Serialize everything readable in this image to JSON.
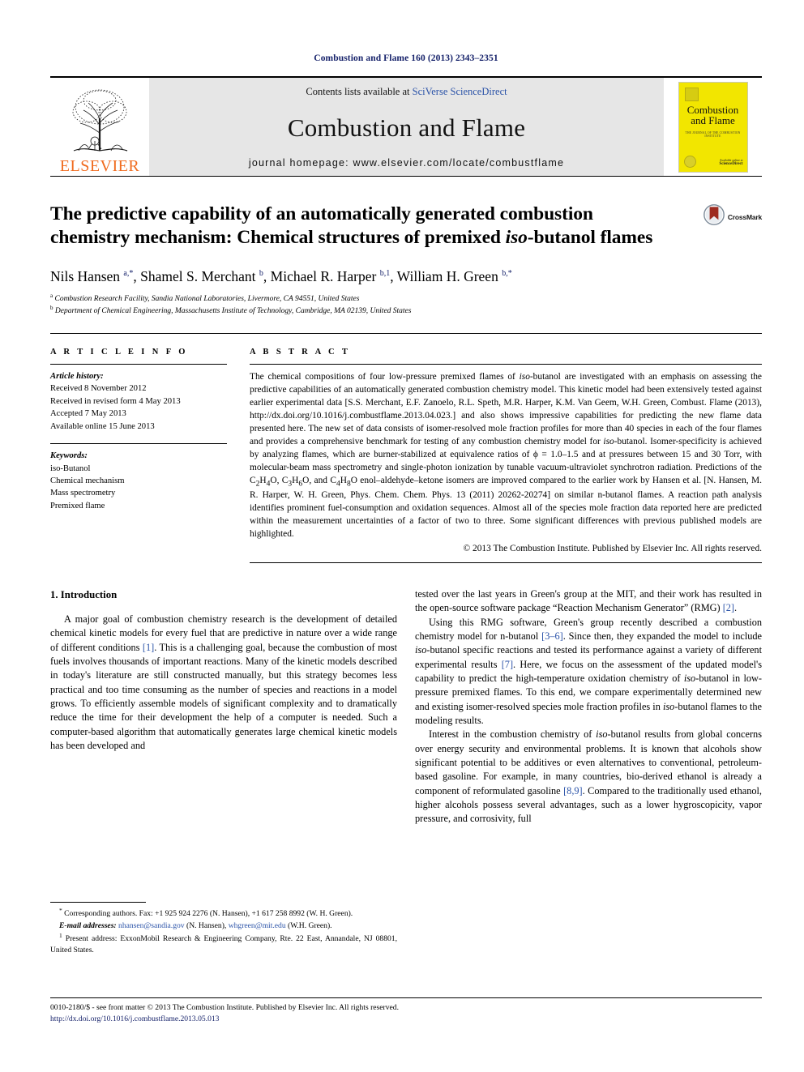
{
  "running_head": "Combustion and Flame 160 (2013) 2343–2351",
  "masthead": {
    "publisher_name": "ELSEVIER",
    "contents_prefix": "Contents lists available at ",
    "contents_link": "SciVerse ScienceDirect",
    "journal_title": "Combustion and Flame",
    "homepage": "journal homepage: www.elsevier.com/locate/combustflame",
    "cover": {
      "title_line1": "Combustion",
      "title_line2": "and Flame",
      "subtitle": "THE JOURNAL OF THE COMBUSTION INSTITUTE",
      "bottom_line1": "Available online at",
      "bottom_line2": "ScienceDirect"
    }
  },
  "article": {
    "title_part1": "The predictive capability of an automatically generated combustion chemistry mechanism: Chemical structures of premixed ",
    "title_italic": "iso",
    "title_part2": "-butanol flames",
    "crossmark_label": "CrossMark",
    "authors_html": "Nils Hansen <sup>a,*</sup>, Shamel S. Merchant <sup>b</sup>, Michael R. Harper <sup>b,1</sup>, William H. Green <sup>b,*</sup>",
    "affiliation_a": "Combustion Research Facility, Sandia National Laboratories, Livermore, CA 94551, United States",
    "affiliation_b": "Department of Chemical Engineering, Massachusetts Institute of Technology, Cambridge, MA 02139, United States"
  },
  "article_info": {
    "heading": "A R T I C L E  I N F O",
    "history_label": "Article history:",
    "history": [
      "Received 8 November 2012",
      "Received in revised form 4 May 2013",
      "Accepted 7 May 2013",
      "Available online 15 June 2013"
    ],
    "keywords_label": "Keywords:",
    "keywords": [
      "iso-Butanol",
      "Chemical mechanism",
      "Mass spectrometry",
      "Premixed flame"
    ]
  },
  "abstract": {
    "heading": "A B S T R A C T",
    "text_html": "The chemical compositions of four low-pressure premixed flames of <span class=\"it\">iso</span>-butanol are investigated with an emphasis on assessing the predictive capabilities of an automatically generated combustion chemistry model. This kinetic model had been extensively tested against earlier experimental data [S.S. Merchant, E.F. Zanoelo, R.L. Speth, M.R. Harper, K.M. Van Geem, W.H. Green, Combust. Flame (2013), http://dx.doi.org/10.1016/j.combustflame.2013.04.023.] and also shows impressive capabilities for predicting the new flame data presented here. The new set of data consists of isomer-resolved mole fraction profiles for more than 40 species in each of the four flames and provides a comprehensive benchmark for testing of any combustion chemistry model for <span class=\"it\">iso</span>-butanol. Isomer-specificity is achieved by analyzing flames, which are burner-stabilized at equivalence ratios of &#981; = 1.0&ndash;1.5 and at pressures between 15 and 30 Torr, with molecular-beam mass spectrometry and single-photon ionization by tunable vacuum-ultraviolet synchrotron radiation. Predictions of the C<sub>2</sub>H<sub>4</sub>O, C<sub>3</sub>H<sub>6</sub>O, and C<sub>4</sub>H<sub>8</sub>O enol&ndash;aldehyde&ndash;ketone isomers are improved compared to the earlier work by Hansen et al. [N. Hansen, M. R. Harper, W. H. Green, Phys. Chem. Chem. Phys. 13 (2011) 20262-20274] on similar n-butanol flames. A reaction path analysis identifies prominent fuel-consumption and oxidation sequences. Almost all of the species mole fraction data reported here are predicted within the measurement uncertainties of a factor of two to three. Some significant differences with previous published models are highlighted.",
    "copyright": "© 2013 The Combustion Institute. Published by Elsevier Inc. All rights reserved."
  },
  "introduction": {
    "heading": "1. Introduction",
    "left_paragraphs_html": [
      "A major goal of combustion chemistry research is the development of detailed chemical kinetic models for every fuel that are predictive in nature over a wide range of different conditions <span class=\"ref\">[1]</span>. This is a challenging goal, because the combustion of most fuels involves thousands of important reactions. Many of the kinetic models described in today's literature are still constructed manually, but this strategy becomes less practical and too time consuming as the number of species and reactions in a model grows. To efficiently assemble models of significant complexity and to dramatically reduce the time for their development the help of a computer is needed. Such a computer-based algorithm that automatically generates large chemical kinetic models has been developed and"
    ],
    "right_paragraphs_html": [
      "tested over the last years in Green's group at the MIT, and their work has resulted in the open-source software package &ldquo;Reaction Mechanism Generator&rdquo; (RMG) <span class=\"ref\">[2]</span>.",
      "Using this RMG software, Green's group recently described a combustion chemistry model for n-butanol <span class=\"ref\">[3&ndash;6]</span>. Since then, they expanded the model to include <span class=\"it\">iso</span>-butanol specific reactions and tested its performance against a variety of different experimental results <span class=\"ref\">[7]</span>. Here, we focus on the assessment of the updated model's capability to predict the high-temperature oxidation chemistry of <span class=\"it\">iso</span>-butanol in low-pressure premixed flames. To this end, we compare experimentally determined new and existing isomer-resolved species mole fraction profiles in <span class=\"it\">iso</span>-butanol flames to the modeling results.",
      "Interest in the combustion chemistry of <span class=\"it\">iso</span>-butanol results from global concerns over energy security and environmental problems. It is known that alcohols show significant potential to be additives or even alternatives to conventional, petroleum-based gasoline. For example, in many countries, bio-derived ethanol is already a component of reformulated gasoline <span class=\"ref\">[8,9]</span>. Compared to the traditionally used ethanol, higher alcohols possess several advantages, such as a lower hygroscopicity, vapor pressure, and corrosivity, full"
    ]
  },
  "footnotes": {
    "corresponding_html": "<sup>*</sup> Corresponding authors. Fax: +1 925 924 2276 (N. Hansen), +1 617 258 8992 (W. H. Green).",
    "email_html": "<span class=\"lbl-it\">E-mail addresses:</span> <span class=\"mail\">nhansen@sandia.gov</span> (N. Hansen), <span class=\"mail\">whgreen@mit.edu</span> (W.H. Green).",
    "present_address_html": "<sup>1</sup> Present address: ExxonMobil Research &amp; Engineering Company, Rte. 22 East, Annandale, NJ 08801, United States."
  },
  "page_footer": {
    "issn_line": "0010-2180/$ - see front matter © 2013 The Combustion Institute. Published by Elsevier Inc. All rights reserved.",
    "doi": "http://dx.doi.org/10.1016/j.combustflame.2013.05.013"
  }
}
